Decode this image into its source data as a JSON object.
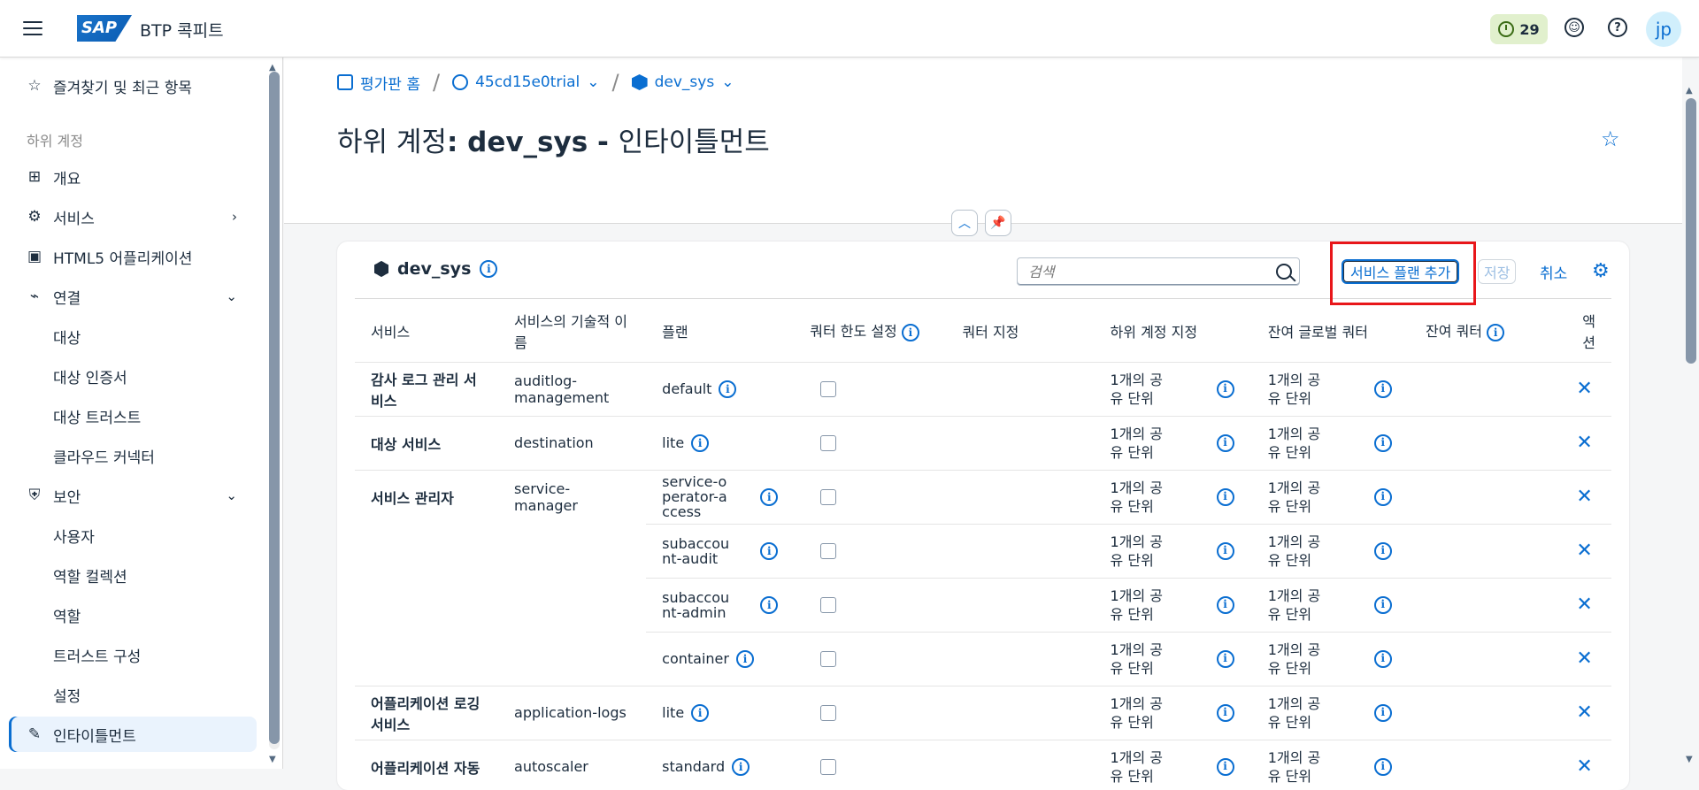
{
  "shell": {
    "product": "BTP 콕피트",
    "logo": "SAP",
    "badge_count": "29",
    "avatar": "jp"
  },
  "sidebar": {
    "favorites": "즐겨찾기 및 최근 항목",
    "group": "하위 계정",
    "items": [
      {
        "label": "개요",
        "icon": "hierarchy-icon"
      },
      {
        "label": "서비스",
        "icon": "services-icon"
      },
      {
        "label": "HTML5 어플리케이션",
        "icon": "html5-icon"
      },
      {
        "label": "연결",
        "icon": "connection-icon"
      },
      {
        "label": "대상"
      },
      {
        "label": "대상 인증서"
      },
      {
        "label": "대상 트러스트"
      },
      {
        "label": "클라우드 커넥터"
      },
      {
        "label": "보안",
        "icon": "shield-icon"
      },
      {
        "label": "사용자"
      },
      {
        "label": "역할 컬렉션"
      },
      {
        "label": "역할"
      },
      {
        "label": "트러스트 구성"
      },
      {
        "label": "설정"
      },
      {
        "label": "인타이틀먼트",
        "icon": "entitlement-icon"
      }
    ]
  },
  "breadcrumbs": {
    "home": "평가판 홈",
    "account": "45cd15e0trial",
    "subaccount": "dev_sys"
  },
  "page": {
    "title_prefix": "하위 계정",
    "title_name": ": dev_sys - ",
    "title_suffix": "인타이틀먼트"
  },
  "card": {
    "title": "dev_sys",
    "search_placeholder": "검색",
    "add_button": "서비스 플랜 추가",
    "save_button": "저장",
    "cancel_button": "취소"
  },
  "table": {
    "headers": [
      "서비스",
      "서비스의 기술적 이름",
      "플랜",
      "쿼터 한도 설정",
      "쿼터 지정",
      "하위 계정 지정",
      "잔여 글로벌 쿼터",
      "잔여 쿼터",
      "액션"
    ],
    "quota_text": "1개의 공유 단위",
    "rows": [
      {
        "service": "감사 로그 관리 서비스",
        "tech": "auditlog-management",
        "plan": "default"
      },
      {
        "service": "대상 서비스",
        "tech": "destination",
        "plan": "lite"
      },
      {
        "service": "서비스 관리자",
        "tech": "service-manager",
        "plan": "service-operator-access"
      },
      {
        "service": "",
        "tech": "",
        "plan": "subaccount-audit"
      },
      {
        "service": "",
        "tech": "",
        "plan": "subaccount-admin"
      },
      {
        "service": "",
        "tech": "",
        "plan": "container"
      },
      {
        "service": "어플리케이션 로깅 서비스",
        "tech": "application-logs",
        "plan": "lite"
      },
      {
        "service": "어플리케이션 자동",
        "tech": "autoscaler",
        "plan": "standard"
      }
    ]
  }
}
